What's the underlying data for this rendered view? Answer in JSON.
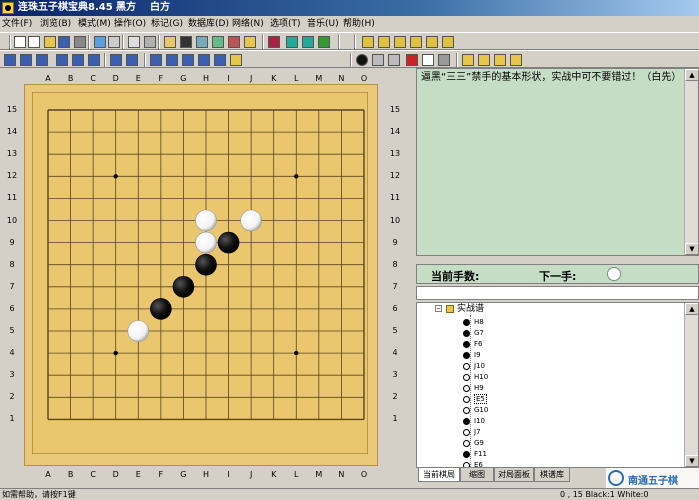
{
  "window": {
    "title": "连珠五子棋宝典8.45",
    "black_label": "黑方",
    "white_label": "白方"
  },
  "menu": [
    "文件(F)",
    "浏览(B)",
    "模式(M)",
    "操作(O)",
    "标记(G)",
    "数据库(D)",
    "网络(N)",
    "选项(T)",
    "音乐(U)",
    "帮助(H)"
  ],
  "toolbar1_icons": [
    "new-icon",
    "open-icon",
    "folder-icon",
    "save-icon",
    "print-icon",
    "chart-icon",
    "save-as-icon",
    "paste-icon",
    "edit-icon",
    "board-icon",
    "grid-icon",
    "copy-icon",
    "export-icon",
    "home-icon",
    "question-icon",
    "book-icon",
    "arrow-up-icon",
    "arrow-down-icon",
    "tree-icon",
    "db1-icon",
    "db2-icon",
    "db3-icon",
    "db4-icon",
    "db5-icon",
    "db6-icon"
  ],
  "toolbar2_icons": [
    "first-icon",
    "prev-branch-icon",
    "back-icon",
    "forward-icon",
    "next-branch-icon",
    "last-icon",
    "prev-step-icon",
    "next-step-icon",
    "flip-h-icon",
    "flip-v-icon",
    "rotate-left-icon",
    "rotate-right-icon",
    "mirror-icon",
    "sun-icon",
    "stone-black-icon",
    "move-up-icon",
    "move-down-icon",
    "marker-red-icon",
    "square-icon",
    "cross-icon",
    "grid-a-icon",
    "grid-b-icon",
    "grid-c-icon",
    "grid-d-icon"
  ],
  "board": {
    "size": 15,
    "columns": [
      "A",
      "B",
      "C",
      "D",
      "E",
      "F",
      "G",
      "H",
      "I",
      "J",
      "K",
      "L",
      "M",
      "N",
      "O"
    ],
    "rows": [
      "15",
      "14",
      "13",
      "12",
      "11",
      "10",
      "9",
      "8",
      "7",
      "6",
      "5",
      "4",
      "3",
      "2",
      "1"
    ],
    "star_points": [
      "D12",
      "L12",
      "H8",
      "D4",
      "L4"
    ],
    "stones": [
      {
        "pos": "H10",
        "color": "white"
      },
      {
        "pos": "J10",
        "color": "white"
      },
      {
        "pos": "H9",
        "color": "white"
      },
      {
        "pos": "I9",
        "color": "black"
      },
      {
        "pos": "H8",
        "color": "black"
      },
      {
        "pos": "G7",
        "color": "black"
      },
      {
        "pos": "F6",
        "color": "black"
      },
      {
        "pos": "E5",
        "color": "white"
      }
    ],
    "colors": {
      "frame": "#e9c979",
      "board": "#eac76f",
      "line": "#5a4420",
      "black": "#111111",
      "white": "#ffffff"
    }
  },
  "comment": "逼黑“三三”禁手的基本形状，实战中可不要错过！（白先）",
  "move_bar": {
    "current_label": "当前手数:",
    "next_label": "下一手:"
  },
  "tree": {
    "root_label": "实战谱",
    "nodes": [
      {
        "label": "H8",
        "color": "black"
      },
      {
        "label": "G7",
        "color": "black"
      },
      {
        "label": "F6",
        "color": "black"
      },
      {
        "label": "I9",
        "color": "black"
      },
      {
        "label": "J10",
        "color": "white"
      },
      {
        "label": "H10",
        "color": "white"
      },
      {
        "label": "H9",
        "color": "white"
      },
      {
        "label": "E5",
        "color": "white"
      },
      {
        "label": "G10",
        "color": "white"
      },
      {
        "label": "I10",
        "color": "black"
      },
      {
        "label": "J7",
        "color": "white"
      },
      {
        "label": "G9",
        "color": "white"
      },
      {
        "label": "F11",
        "color": "black"
      },
      {
        "label": "E6",
        "color": "white"
      },
      {
        "label": "I8",
        "color": "black"
      }
    ]
  },
  "tabs": [
    "当前棋局",
    "缩图",
    "对局面板",
    "棋谱库"
  ],
  "status": {
    "left": "如需帮助，请按F1键",
    "right": "0 , 15  Black:1  White:0"
  },
  "watermark": "南通五子棋"
}
